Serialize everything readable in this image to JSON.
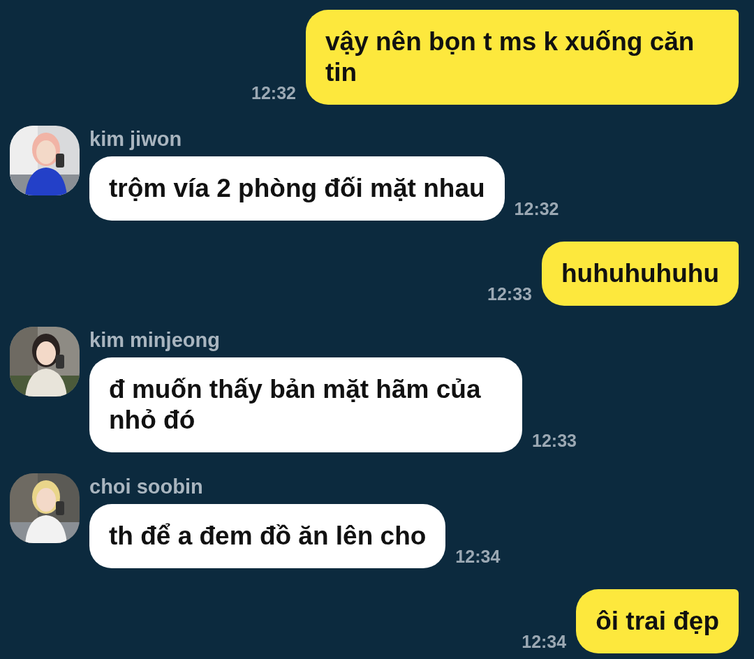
{
  "messages": [
    {
      "kind": "outgoing",
      "text": "vậy nên bọn t ms k xuống căn tin",
      "time": "12:32"
    },
    {
      "kind": "incoming",
      "sender": "kim jiwon",
      "text": "trộm vía 2 phòng đối mặt nhau",
      "time": "12:32"
    },
    {
      "kind": "outgoing",
      "text": "huhuhuhuhu",
      "time": "12:33"
    },
    {
      "kind": "incoming",
      "sender": "kim minjeong",
      "text": "đ muốn thấy bản mặt hãm của nhỏ đó",
      "time": "12:33"
    },
    {
      "kind": "incoming",
      "sender": "choi soobin",
      "text": "th để a đem đồ ăn lên cho",
      "time": "12:34"
    },
    {
      "kind": "outgoing",
      "text": "ôi trai đẹp",
      "time": "12:34"
    }
  ]
}
